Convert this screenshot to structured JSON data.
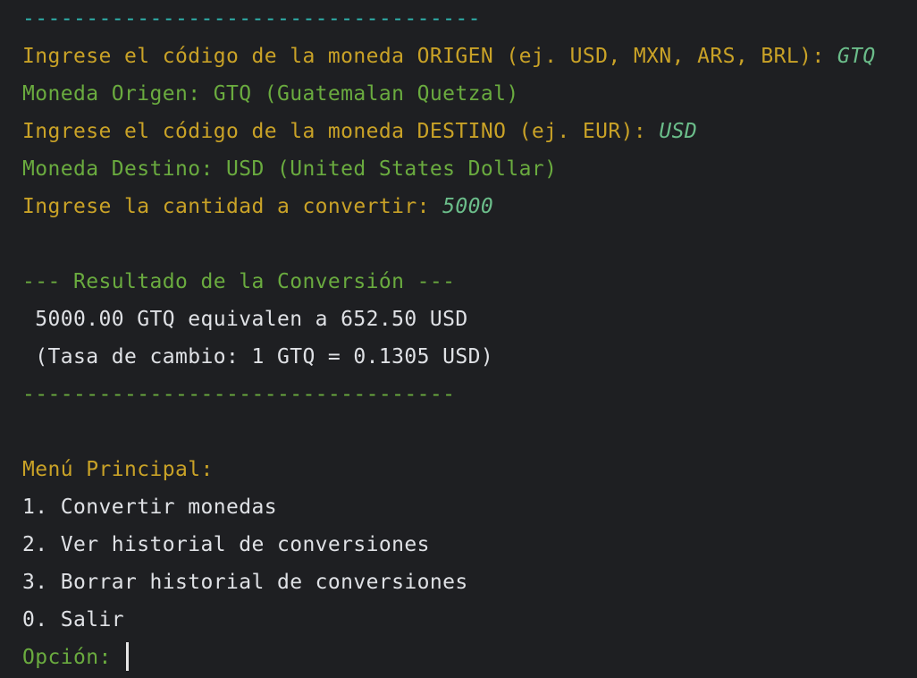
{
  "console": {
    "separator_top": "------------------------------------",
    "origin_prompt": "Ingrese el código de la moneda ORIGEN (ej. USD, MXN, ARS, BRL): ",
    "origin_input": "GTQ",
    "origin_result": "Moneda Origen: GTQ (Guatemalan Quetzal)",
    "dest_prompt": "Ingrese el código de la moneda DESTINO (ej. EUR): ",
    "dest_input": "USD",
    "dest_result": "Moneda Destino: USD (United States Dollar)",
    "amount_prompt": "Ingrese la cantidad a convertir: ",
    "amount_input": "5000",
    "result_header": "--- Resultado de la Conversión ---",
    "result_line": " 5000.00 GTQ equivalen a 652.50 USD",
    "rate_line": " (Tasa de cambio: 1 GTQ = 0.1305 USD)",
    "separator_bottom": "----------------------------------",
    "menu_title": "Menú Principal:",
    "menu_items": [
      "1. Convertir monedas",
      "2. Ver historial de conversiones",
      "3. Borrar historial de conversiones",
      "0. Salir"
    ],
    "option_prompt": "Opción: "
  },
  "colors": {
    "background": "#1e1f22",
    "separator": "#2fb7b1",
    "prompt": "#c9a227",
    "info": "#6aab3f",
    "output": "#dfe1e5",
    "user_input": "#6bbd8a"
  }
}
